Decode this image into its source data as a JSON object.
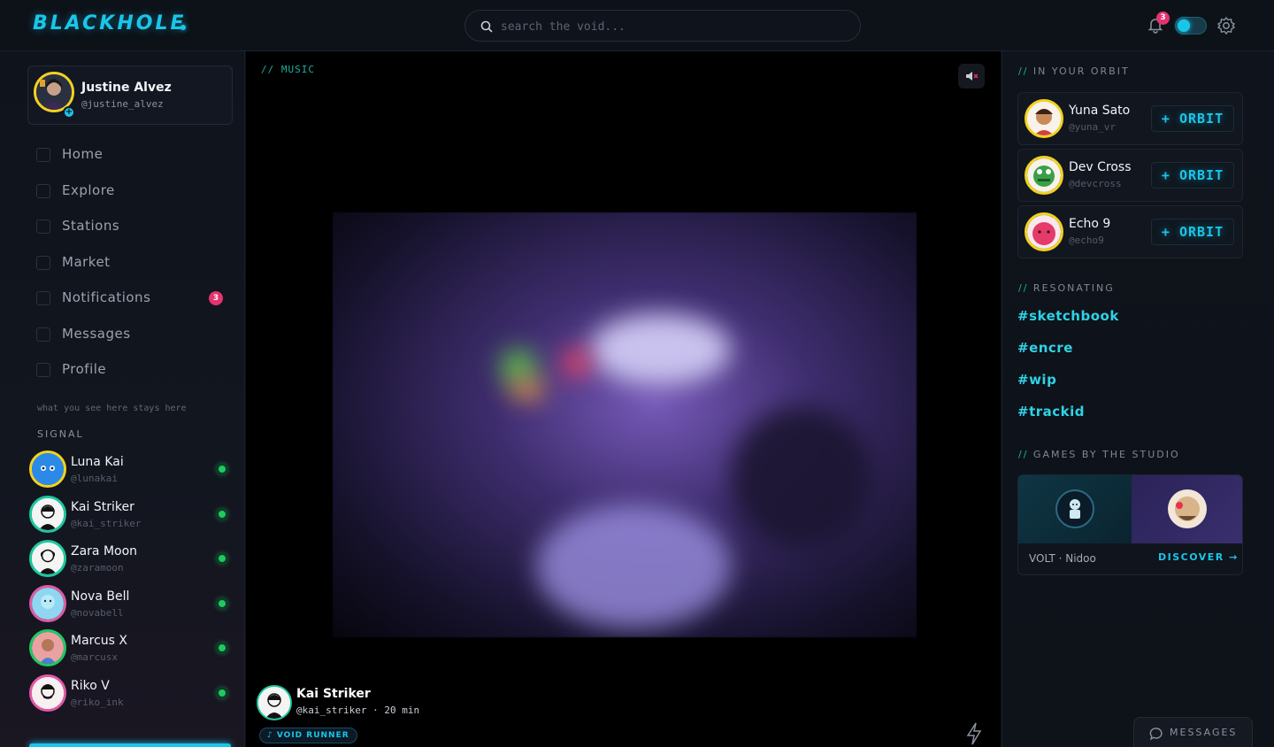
{
  "app": {
    "logo": "BLACKHOLE"
  },
  "search": {
    "placeholder": "search the void..."
  },
  "header": {
    "notification_count": "3"
  },
  "profile": {
    "name": "Justine Alvez",
    "handle": "@justine_alvez"
  },
  "nav": [
    {
      "label": "Home"
    },
    {
      "label": "Explore"
    },
    {
      "label": "Stations"
    },
    {
      "label": "Market"
    },
    {
      "label": "Notifications",
      "badge": "3"
    },
    {
      "label": "Messages"
    },
    {
      "label": "Profile"
    }
  ],
  "privacy_note": "what you see here stays here",
  "signal": {
    "heading": "SIGNAL",
    "users": [
      {
        "name": "Luna Kai",
        "handle": "@lunakai"
      },
      {
        "name": "Kai Striker",
        "handle": "@kai_striker"
      },
      {
        "name": "Zara Moon",
        "handle": "@zaramoon"
      },
      {
        "name": "Nova Bell",
        "handle": "@novabell"
      },
      {
        "name": "Marcus X",
        "handle": "@marcusx"
      },
      {
        "name": "Riko V",
        "handle": "@riko_ink"
      }
    ]
  },
  "post": {
    "category": "// MUSIC",
    "author": "Kai Striker",
    "meta": "@kai_striker · 20 min",
    "track": "♪ VOID RUNNER"
  },
  "orbit": {
    "heading": "IN YOUR ORBIT",
    "users": [
      {
        "name": "Yuna Sato",
        "handle": "@yuna_vr",
        "button": "+ ORBIT"
      },
      {
        "name": "Dev Cross",
        "handle": "@devcross",
        "button": "+ ORBIT"
      },
      {
        "name": "Echo 9",
        "handle": "@echo9",
        "button": "+ ORBIT"
      }
    ]
  },
  "resonating": {
    "heading": "RESONATING",
    "tags": [
      "#sketchbook",
      "#encre",
      "#wip",
      "#trackid"
    ]
  },
  "games": {
    "heading": "GAMES BY THE STUDIO",
    "label": "VOLT · Nidoo",
    "discover": "DISCOVER →"
  },
  "messages_button": "MESSAGES",
  "colors": {
    "accent": "#19c6ea",
    "badge": "#e5336f",
    "online": "#1ec964",
    "ring": "#f3d21f"
  }
}
